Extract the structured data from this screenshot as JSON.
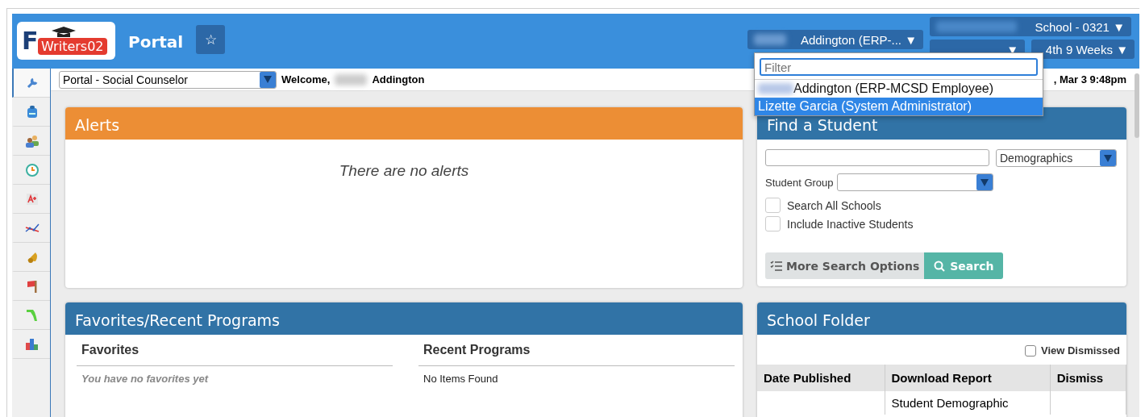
{
  "header": {
    "logo_letter": "F",
    "badge": "Writers02",
    "title": "Portal",
    "favorite_star": "☆",
    "user_menu": {
      "label": "Addington (ERP-...",
      "caret": "▼",
      "redacted": true
    },
    "school_menu": {
      "label": "School - 0321",
      "caret": "▼",
      "redacted": true
    },
    "year_menu": {
      "caret": "▼"
    },
    "term_menu": {
      "label": "4th 9 Weeks",
      "caret": "▼"
    }
  },
  "user_dropdown": {
    "filter_placeholder": "Filter",
    "options": [
      {
        "label": "Addington (ERP-MCSD Employee)",
        "redacted": true,
        "selected": false
      },
      {
        "label": "Lizette Garcia (System Administrator)",
        "redacted": false,
        "selected": true
      }
    ]
  },
  "toolbar": {
    "role_select": "Portal - Social Counselor",
    "welcome": "Welcome,",
    "user_name": "Addington",
    "date": ", Mar 3 9:48pm"
  },
  "sidebar": {
    "items": [
      {
        "kind": "wrench",
        "selected": true
      },
      {
        "kind": "backpack",
        "selected": false
      },
      {
        "kind": "people",
        "selected": false
      },
      {
        "kind": "clock",
        "selected": false
      },
      {
        "kind": "grade",
        "selected": false
      },
      {
        "kind": "trend",
        "selected": false
      },
      {
        "kind": "bell",
        "selected": false
      },
      {
        "kind": "flag",
        "selected": false
      },
      {
        "kind": "state",
        "selected": false
      },
      {
        "kind": "chart",
        "selected": false
      }
    ]
  },
  "alerts": {
    "title": "Alerts",
    "message": "There are no alerts"
  },
  "find_student": {
    "title": "Find a Student",
    "search_type": "Demographics",
    "group_label": "Student Group",
    "checkboxes": [
      {
        "label": "Search All Schools",
        "checked": false
      },
      {
        "label": "Include Inactive Students",
        "checked": false
      }
    ],
    "more_button": "More Search Options",
    "search_button": "Search"
  },
  "favorites": {
    "title": "Favorites/Recent Programs",
    "columns": [
      {
        "heading": "Favorites",
        "empty": "You have no favorites yet",
        "kind": "hint"
      },
      {
        "heading": "Recent Programs",
        "empty": "No Items Found",
        "kind": "plain"
      }
    ]
  },
  "school_folder": {
    "title": "School Folder",
    "view_dismissed": {
      "label": "View Dismissed",
      "checked": false
    },
    "columns": [
      "Date Published",
      "Download Report",
      "Dismiss"
    ],
    "rows": [
      [
        "",
        "Student Demographic",
        ""
      ]
    ]
  }
}
